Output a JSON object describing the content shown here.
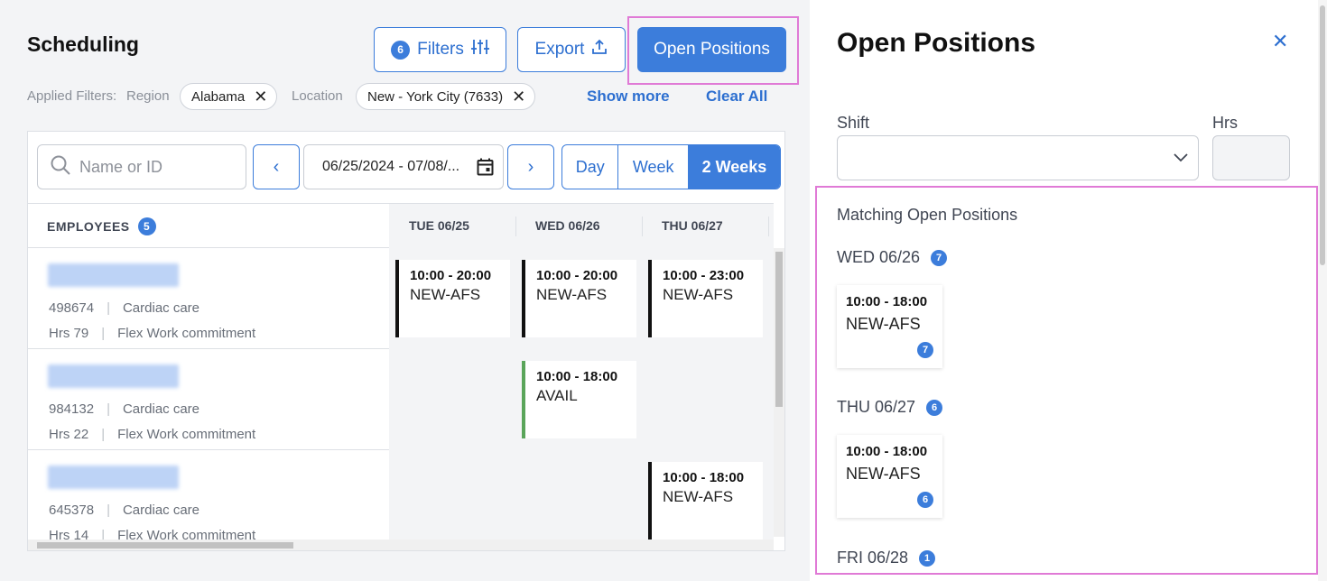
{
  "header": {
    "title": "Scheduling",
    "filters_label": "Filters",
    "filters_count": "6",
    "export_label": "Export",
    "open_positions_label": "Open Positions"
  },
  "applied_filters": {
    "label": "Applied Filters:",
    "region_label": "Region",
    "region_value": "Alabama",
    "location_label": "Location",
    "location_value": "New - York City (7633)",
    "show_more": "Show more",
    "clear_all": "Clear All"
  },
  "toolbar": {
    "search_placeholder": "Name or ID",
    "date_range": "06/25/2024 - 07/08/...",
    "views": [
      "Day",
      "Week",
      "2 Weeks"
    ],
    "active_view": "2 Weeks"
  },
  "grid": {
    "employees_label": "EMPLOYEES",
    "employees_count": "5",
    "days": [
      "TUE 06/25",
      "WED 06/26",
      "THU 06/27"
    ],
    "rows": [
      {
        "id": "498674",
        "dept": "Cardiac care",
        "hrs": "Hrs 79",
        "commitment": "Flex Work commitment",
        "shifts": [
          {
            "time": "10:00 - 20:00",
            "name": "NEW-AFS"
          },
          {
            "time": "10:00 - 20:00",
            "name": "NEW-AFS"
          },
          {
            "time": "10:00 - 23:00",
            "name": "NEW-AFS"
          }
        ]
      },
      {
        "id": "984132",
        "dept": "Cardiac care",
        "hrs": "Hrs 22",
        "commitment": "Flex Work commitment",
        "shifts": [
          null,
          {
            "time": "10:00 - 18:00",
            "name": "AVAIL",
            "status": "available"
          },
          null
        ]
      },
      {
        "id": "645378",
        "dept": "Cardiac care",
        "hrs": "Hrs 14",
        "commitment": "Flex Work commitment",
        "shifts": [
          null,
          null,
          {
            "time": "10:00 - 18:00",
            "name": "NEW-AFS"
          }
        ]
      }
    ]
  },
  "drawer": {
    "title": "Open Positions",
    "shift_label": "Shift",
    "shift_value": "",
    "hrs_label": "Hrs",
    "hrs_value": "",
    "matching_label": "Matching Open Positions",
    "groups": [
      {
        "day": "WED 06/26",
        "count": "7",
        "cards": [
          {
            "time": "10:00 - 18:00",
            "name": "NEW-AFS",
            "count": "7"
          }
        ]
      },
      {
        "day": "THU 06/27",
        "count": "6",
        "cards": [
          {
            "time": "10:00 - 18:00",
            "name": "NEW-AFS",
            "count": "6"
          }
        ]
      },
      {
        "day": "FRI 06/28",
        "count": "1",
        "cards": []
      }
    ]
  },
  "colors": {
    "accent": "#3c7ddb",
    "highlight": "#e07ad6",
    "available": "#5aa55a"
  }
}
